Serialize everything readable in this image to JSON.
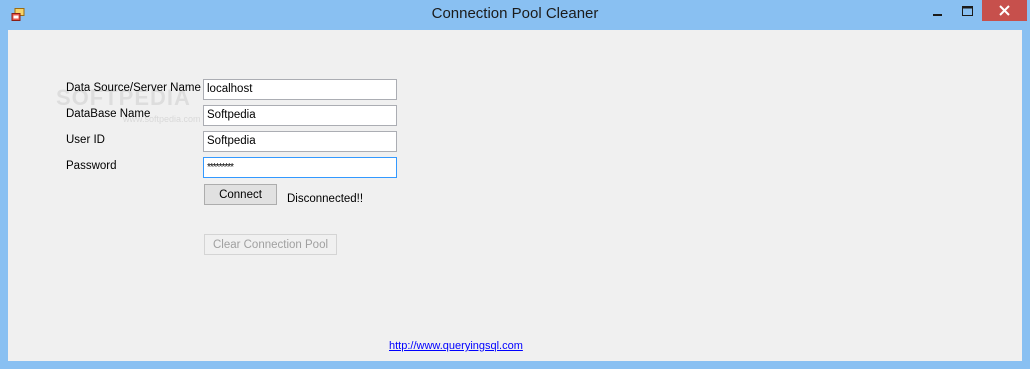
{
  "window": {
    "title": "Connection Pool Cleaner",
    "minimize_glyph": "minimize-icon",
    "maximize_glyph": "maximize-icon",
    "close_glyph": "close-icon",
    "colors": {
      "frame": "#89c0f2",
      "close": "#c7504c",
      "client": "#f0f0f0"
    }
  },
  "watermark": {
    "main": "SOFTPEDIA",
    "sub": "www.softpedia.com"
  },
  "form": {
    "server_label": "Data Source/Server Name",
    "server_value": "localhost",
    "database_label": "DataBase Name",
    "database_value": "Softpedia",
    "userid_label": "User ID",
    "userid_value": "Softpedia",
    "password_label": "Password",
    "password_value": "*********"
  },
  "actions": {
    "connect_label": "Connect",
    "status_text": "Disconnected!!",
    "clear_pool_label": "Clear Connection Pool"
  },
  "footer": {
    "link_text": "http://www.queryingsql.com"
  }
}
